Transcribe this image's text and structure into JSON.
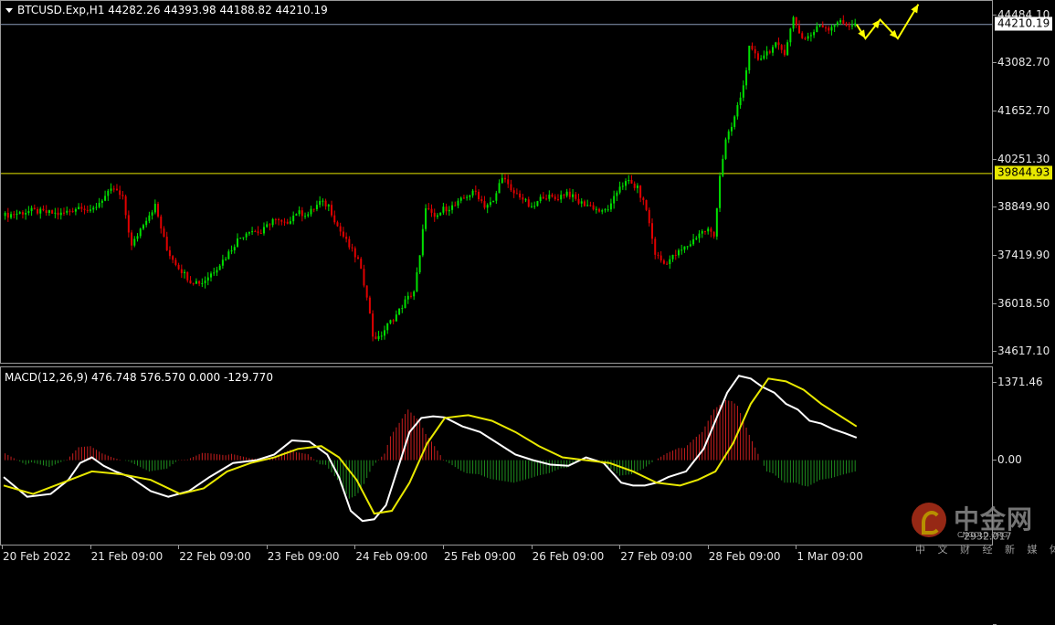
{
  "header": {
    "symbol": "BTCUSD.Exp,H1",
    "ohlc": "44282.26 44393.98 44188.82 44210.19"
  },
  "macd_header": "MACD(12,26,9) 476.748 576.570 0.000 -129.770",
  "price_axis": {
    "labels": [
      "44484.10",
      "43082.70",
      "41652.70",
      "40251.30",
      "38849.90",
      "37419.90",
      "36018.50",
      "34617.10"
    ],
    "current_price_tag": "44210.19",
    "level_tag": "39844.93"
  },
  "macd_axis": {
    "labels": [
      "1371.46",
      "0.00",
      "-2932.017"
    ]
  },
  "time_axis": {
    "labels": [
      "20 Feb 2022",
      "21 Feb 09:00",
      "22 Feb 09:00",
      "23 Feb 09:00",
      "24 Feb 09:00",
      "25 Feb 09:00",
      "26 Feb 09:00",
      "27 Feb 09:00",
      "28 Feb 09:00",
      "1 Mar 09:00"
    ]
  },
  "colors": {
    "bull": "#00e000",
    "bear": "#e00000",
    "level_line": "#e8e800",
    "price_line": "#8a9ab8",
    "macd_line": "#ffffff",
    "signal_line": "#e8e800",
    "hist_pos": "#c81e1e",
    "hist_neg": "#1e8c1e",
    "arrow": "#ffff00"
  },
  "watermark": {
    "name": "中金网",
    "url": "CNGOLD.ORG",
    "slogan": "中 文 财 经 新 媒 体"
  },
  "chart_data": [
    {
      "type": "candlestick",
      "title": "BTCUSD.Exp,H1",
      "x_labels": [
        "20 Feb 2022",
        "21 Feb 09:00",
        "22 Feb 09:00",
        "23 Feb 09:00",
        "24 Feb 09:00",
        "25 Feb 09:00",
        "26 Feb 09:00",
        "27 Feb 09:00",
        "28 Feb 09:00",
        "1 Mar 09:00"
      ],
      "ylim": [
        34300,
        44900
      ],
      "close_path": [
        [
          0,
          38600
        ],
        [
          10,
          38750
        ],
        [
          20,
          38650
        ],
        [
          27,
          38900
        ],
        [
          30,
          38700
        ],
        [
          34,
          39100
        ],
        [
          38,
          39400
        ],
        [
          41,
          39100
        ],
        [
          44,
          37700
        ],
        [
          48,
          38400
        ],
        [
          52,
          38900
        ],
        [
          56,
          37600
        ],
        [
          60,
          37100
        ],
        [
          64,
          36700
        ],
        [
          68,
          36650
        ],
        [
          72,
          37000
        ],
        [
          76,
          37400
        ],
        [
          80,
          37900
        ],
        [
          84,
          38200
        ],
        [
          88,
          38100
        ],
        [
          92,
          38500
        ],
        [
          96,
          38350
        ],
        [
          100,
          38700
        ],
        [
          104,
          38650
        ],
        [
          108,
          39000
        ],
        [
          111,
          38900
        ],
        [
          114,
          38300
        ],
        [
          118,
          37700
        ],
        [
          121,
          37300
        ],
        [
          124,
          36300
        ],
        [
          126,
          35100
        ],
        [
          128,
          35000
        ],
        [
          131,
          35400
        ],
        [
          134,
          35700
        ],
        [
          137,
          36100
        ],
        [
          140,
          36400
        ],
        [
          142,
          37400
        ],
        [
          144,
          38900
        ],
        [
          147,
          38500
        ],
        [
          150,
          38800
        ],
        [
          154,
          38900
        ],
        [
          158,
          39200
        ],
        [
          161,
          39300
        ],
        [
          164,
          38900
        ],
        [
          167,
          39000
        ],
        [
          170,
          39800
        ],
        [
          173,
          39300
        ],
        [
          176,
          39200
        ],
        [
          180,
          38800
        ],
        [
          184,
          39200
        ],
        [
          188,
          39100
        ],
        [
          192,
          39300
        ],
        [
          196,
          39000
        ],
        [
          200,
          38900
        ],
        [
          204,
          38700
        ],
        [
          207,
          38900
        ],
        [
          210,
          39500
        ],
        [
          213,
          39600
        ],
        [
          216,
          39400
        ],
        [
          219,
          38800
        ],
        [
          222,
          37500
        ],
        [
          225,
          37200
        ],
        [
          228,
          37400
        ],
        [
          231,
          37600
        ],
        [
          234,
          37800
        ],
        [
          237,
          38100
        ],
        [
          240,
          38200
        ],
        [
          242,
          38000
        ],
        [
          244,
          39800
        ],
        [
          246,
          40800
        ],
        [
          248,
          41200
        ],
        [
          250,
          41800
        ],
        [
          252,
          42400
        ],
        [
          254,
          43500
        ],
        [
          257,
          43200
        ],
        [
          260,
          43400
        ],
        [
          263,
          43600
        ],
        [
          266,
          43400
        ],
        [
          269,
          44400
        ],
        [
          272,
          43800
        ],
        [
          275,
          43900
        ],
        [
          278,
          44200
        ],
        [
          281,
          44100
        ],
        [
          284,
          44300
        ],
        [
          287,
          44200
        ],
        [
          290,
          44210
        ]
      ],
      "horizontal_levels": [
        44210.19,
        39844.93
      ],
      "projection": [
        [
          290,
          44210
        ],
        [
          293,
          43800
        ],
        [
          298,
          44350
        ],
        [
          304,
          43800
        ],
        [
          311,
          44800
        ]
      ]
    },
    {
      "type": "line",
      "title": "MACD(12,26,9)",
      "ylim": [
        -1500,
        1650
      ],
      "series": [
        {
          "name": "MACD",
          "x": [
            0,
            8,
            16,
            22,
            26,
            30,
            34,
            38,
            43,
            50,
            56,
            63,
            70,
            78,
            86,
            92,
            98,
            104,
            110,
            114,
            118,
            122,
            126,
            130,
            134,
            138,
            142,
            146,
            150,
            156,
            162,
            168,
            174,
            180,
            186,
            192,
            198,
            204,
            210,
            214,
            218,
            222,
            226,
            232,
            238,
            242,
            246,
            250,
            254,
            258,
            262,
            266,
            270,
            274,
            278,
            282,
            286,
            290
          ],
          "values": [
            -300,
            -650,
            -600,
            -350,
            -50,
            50,
            -100,
            -200,
            -300,
            -550,
            -650,
            -550,
            -300,
            -50,
            0,
            100,
            350,
            330,
            100,
            -300,
            -900,
            -1080,
            -1050,
            -800,
            -150,
            500,
            750,
            780,
            760,
            600,
            500,
            300,
            100,
            0,
            -80,
            -100,
            50,
            -50,
            -400,
            -450,
            -450,
            -400,
            -300,
            -200,
            200,
            700,
            1200,
            1500,
            1450,
            1300,
            1200,
            1000,
            900,
            700,
            650,
            550,
            480,
            400
          ]
        },
        {
          "name": "Signal",
          "x": [
            0,
            10,
            20,
            30,
            40,
            50,
            60,
            68,
            76,
            84,
            92,
            100,
            108,
            114,
            120,
            126,
            132,
            138,
            144,
            150,
            158,
            166,
            174,
            182,
            190,
            198,
            206,
            214,
            222,
            230,
            236,
            242,
            248,
            254,
            260,
            266,
            272,
            278,
            284,
            290
          ],
          "values": [
            -450,
            -600,
            -400,
            -200,
            -250,
            -350,
            -600,
            -500,
            -200,
            -50,
            50,
            200,
            250,
            50,
            -350,
            -950,
            -900,
            -400,
            300,
            750,
            800,
            700,
            500,
            250,
            50,
            0,
            -50,
            -200,
            -400,
            -450,
            -350,
            -200,
            300,
            1000,
            1450,
            1400,
            1250,
            1000,
            800,
            600
          ]
        }
      ]
    }
  ]
}
